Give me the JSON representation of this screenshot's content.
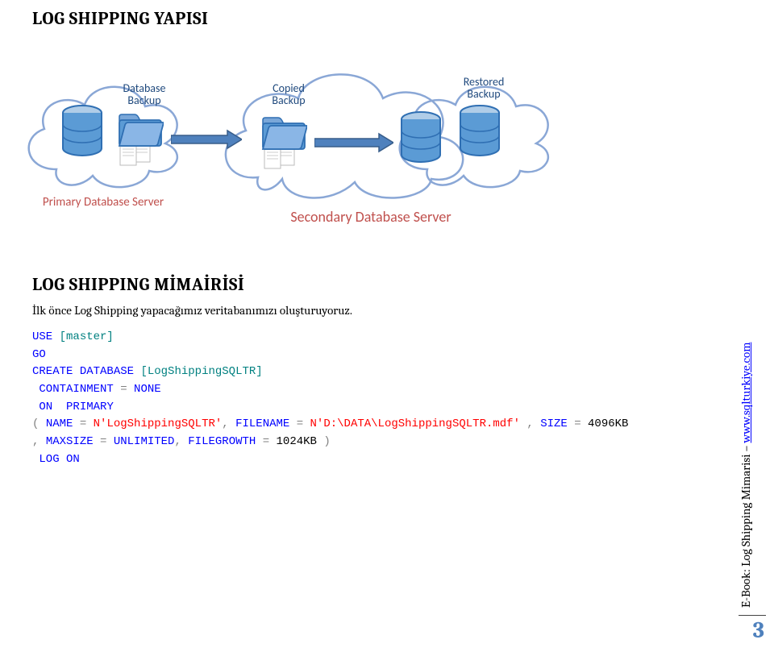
{
  "title": "LOG SHIPPING YAPISI",
  "diagram": {
    "captions": {
      "db_backup": "Database\nBackup",
      "copied_backup": "Copied\nBackup",
      "restored_backup": "Restored\nBackup"
    },
    "servers": {
      "primary": "Primary Database Server",
      "secondary": "Secondary Database Server"
    }
  },
  "subtitle": "LOG SHIPPING MİMAİRİSİ",
  "paragraph": "İlk önce Log Shipping yapacağımız veritabanımızı oluşturuyoruz.",
  "code": {
    "l1a": "USE",
    "l1b": "[master]",
    "l2a": "GO",
    "l3a": "CREATE",
    "l3b": "DATABASE",
    "l3c": "[LogShippingSQLTR]",
    "l4a": "CONTAINMENT",
    "l4b": "=",
    "l4c": "NONE",
    "l5a": "ON",
    "l5b": "PRIMARY",
    "l6a": "(",
    "l6b": "NAME",
    "l6c": "=",
    "l6d": "N'LogShippingSQLTR'",
    "l6e": ",",
    "l6f": "FILENAME",
    "l6g": "=",
    "l6h": "N'D:\\DATA\\LogShippingSQLTR.mdf'",
    "l6i": ",",
    "l6j": "SIZE",
    "l6k": "=",
    "l6l": "4096KB",
    "l7a": ",",
    "l7b": "MAXSIZE",
    "l7c": "=",
    "l7d": "UNLIMITED",
    "l7e": ",",
    "l7f": "FILEGROWTH",
    "l7g": "=",
    "l7h": "1024KB",
    "l7i": ")",
    "l8a": "LOG",
    "l8b": "ON"
  },
  "sidebar": {
    "prefix": "E-Book: ",
    "label": "Log Shipping Mimarisi – ",
    "link": "www.sqlturkiye.com"
  },
  "page_number": "3"
}
